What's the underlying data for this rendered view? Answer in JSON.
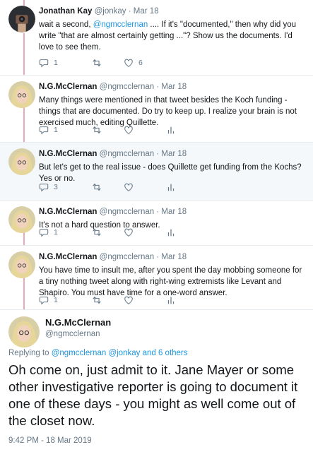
{
  "thread": [
    {
      "name": "Jonathan Kay",
      "handle": "@jonkay",
      "separator": "·",
      "date": "Mar 18",
      "text_parts": [
        "wait a second, ",
        "@ngmcclernan",
        " .... If it's \"documented,\" then why did you write \"that are almost certainly getting ...\"? Show us the documents. I'd love to see them."
      ],
      "reply_count": "1",
      "like_count": "6",
      "shaded": false
    },
    {
      "name": "N.G.McClernan",
      "handle": "@ngmcclernan",
      "separator": "·",
      "date": "Mar 18",
      "text": "Many things were mentioned in that tweet besides the Koch funding - things that are documented. Do try to keep up. I realize your brain is not exercised much, editing Quillette.",
      "reply_count": "1",
      "shaded": false
    },
    {
      "name": "N.G.McClernan",
      "handle": "@ngmcclernan",
      "separator": "·",
      "date": "Mar 18",
      "text": "But let's get to the real issue - does Quillette get funding from the Kochs? Yes or no.",
      "reply_count": "3",
      "shaded": true
    },
    {
      "name": "N.G.McClernan",
      "handle": "@ngmcclernan",
      "separator": "·",
      "date": "Mar 18",
      "text": "It's not a hard question to answer.",
      "reply_count": "1",
      "shaded": false
    },
    {
      "name": "N.G.McClernan",
      "handle": "@ngmcclernan",
      "separator": "·",
      "date": "Mar 18",
      "text": "You have time to insult me, after you spent the day mobbing someone for a tiny nothing tweet along with right-wing extremists like Levant and Shapiro. You must have time for a one-word answer.",
      "reply_count": "1",
      "shaded": false
    }
  ],
  "main_tweet": {
    "name": "N.G.McClernan",
    "handle": "@ngmcclernan",
    "replying_prefix": "Replying to ",
    "replying_user1": "@ngmcclernan",
    "replying_user2": "@jonkay",
    "replying_suffix": " and 6 others",
    "text": "Oh come on, just admit to it. Jane Mayer or some other investigative reporter is going to document it one of these days - you might as well come out of the closet now.",
    "timestamp": "9:42 PM - 18 Mar 2019"
  },
  "colors": {
    "link": "#1b95e0",
    "thread_line": "#e8a9bd",
    "muted": "#657786",
    "shaded_bg": "#f5f8fa"
  },
  "icons": [
    "reply-icon",
    "retweet-icon",
    "like-icon",
    "analytics-icon"
  ]
}
